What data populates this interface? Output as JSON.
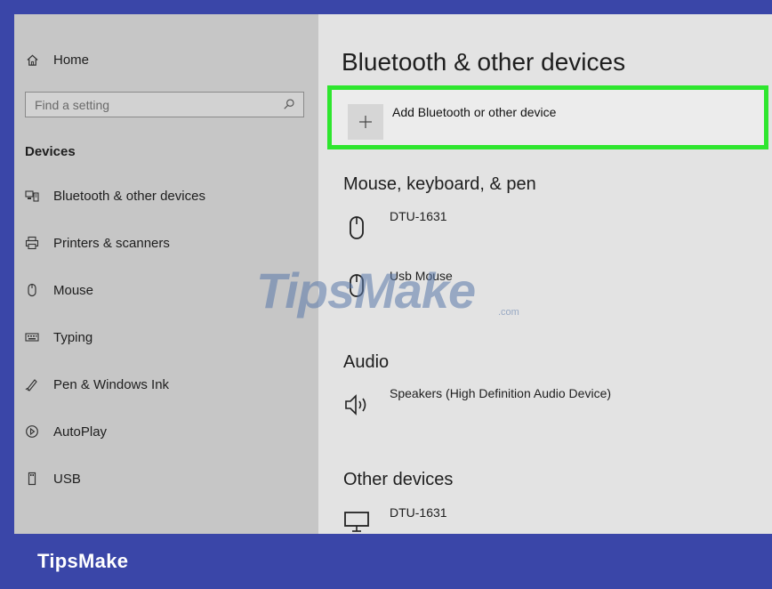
{
  "sidebar": {
    "home_label": "Home",
    "search_placeholder": "Find a setting",
    "section_label": "Devices",
    "items": [
      {
        "label": "Bluetooth & other devices",
        "icon": "bluetooth-devices-icon"
      },
      {
        "label": "Printers & scanners",
        "icon": "printer-icon"
      },
      {
        "label": "Mouse",
        "icon": "mouse-icon"
      },
      {
        "label": "Typing",
        "icon": "keyboard-icon"
      },
      {
        "label": "Pen & Windows Ink",
        "icon": "pen-icon"
      },
      {
        "label": "AutoPlay",
        "icon": "autoplay-icon"
      },
      {
        "label": "USB",
        "icon": "usb-icon"
      }
    ]
  },
  "main": {
    "title": "Bluetooth & other devices",
    "add_device_label": "Add Bluetooth or other device",
    "highlight_color": "#2ee62e",
    "groups": [
      {
        "title": "Mouse, keyboard, & pen",
        "devices": [
          {
            "name": "DTU-1631",
            "icon": "mouse-icon"
          },
          {
            "name": "Usb Mouse",
            "icon": "mouse-icon"
          }
        ]
      },
      {
        "title": "Audio",
        "devices": [
          {
            "name": "Speakers (High Definition Audio Device)",
            "icon": "speaker-icon"
          }
        ]
      },
      {
        "title": "Other devices",
        "devices": [
          {
            "name": "DTU-1631",
            "icon": "monitor-icon"
          }
        ]
      }
    ]
  },
  "watermark": {
    "text": "TipsMake",
    "suffix": ".com"
  },
  "footer": {
    "brand": "TipsMake"
  },
  "colors": {
    "frame": "#3a46a8",
    "sidebar_bg": "#c6c6c6",
    "main_bg": "#e3e3e3"
  }
}
